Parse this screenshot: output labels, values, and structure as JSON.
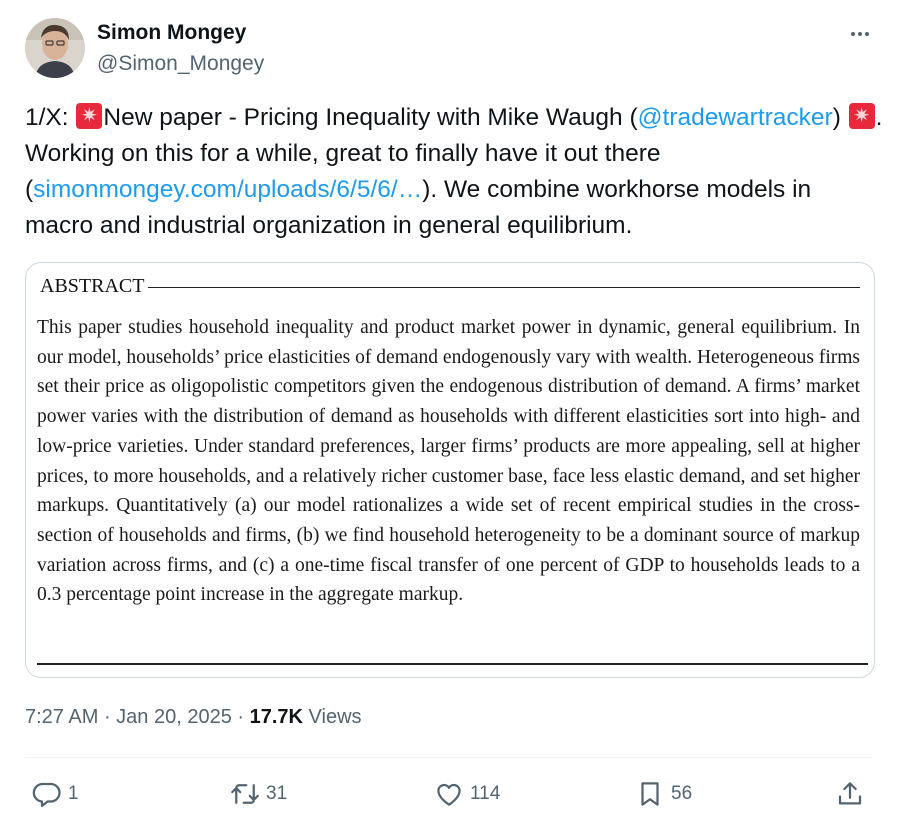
{
  "author": {
    "name": "Simon Mongey",
    "handle": "@Simon_Mongey"
  },
  "tweet": {
    "t1": "1/X: ",
    "t2": "New paper - Pricing Inequality with Mike Waugh (",
    "mention": "@tradewartracker",
    "t3": ") ",
    "t4": ". Working on this for a while, great to finally have it out there (",
    "link": "simonmongey.com/uploads/6/5/6/…",
    "t5": "). We combine workhorse models in macro and industrial organization in general equilibrium."
  },
  "abstract": {
    "heading": "ABSTRACT",
    "body": "This paper studies household inequality and product market power in dynamic, general equilibrium. In our model, households’ price elasticities of demand endogenously vary with wealth. Heterogeneous firms set their price as oligopolistic competitors given the endogenous distribution of demand. A firms’ market power varies with the distribution of demand as households with different elasticities sort into high- and low-price varieties. Under standard preferences, larger firms’ products are more appealing, sell at higher prices, to more households, and a relatively richer customer base, face less elastic demand, and set higher markups. Quantitatively (a) our model rationalizes a wide set of recent empirical studies in the cross-section of households and firms, (b) we find household heterogeneity to be a dominant source of markup variation across firms, and (c) a one-time fiscal transfer of one percent of GDP to households leads to a 0.3 percentage point increase in the aggregate markup."
  },
  "meta": {
    "time": "7:27 AM",
    "sep1": " · ",
    "date": "Jan 20, 2025",
    "sep2": " · ",
    "views_count": "17.7K",
    "views_label": " Views"
  },
  "actions": {
    "replies": "1",
    "reposts": "31",
    "likes": "114",
    "bookmarks": "56"
  },
  "icons": [
    "avatar",
    "more-icon",
    "siren-emoji",
    "reply-icon",
    "repost-icon",
    "like-icon",
    "bookmark-icon",
    "share-icon"
  ],
  "colors": {
    "link": "#1d9bf0",
    "text": "#0f1419",
    "secondary": "#536471",
    "border": "#cfd9de"
  }
}
